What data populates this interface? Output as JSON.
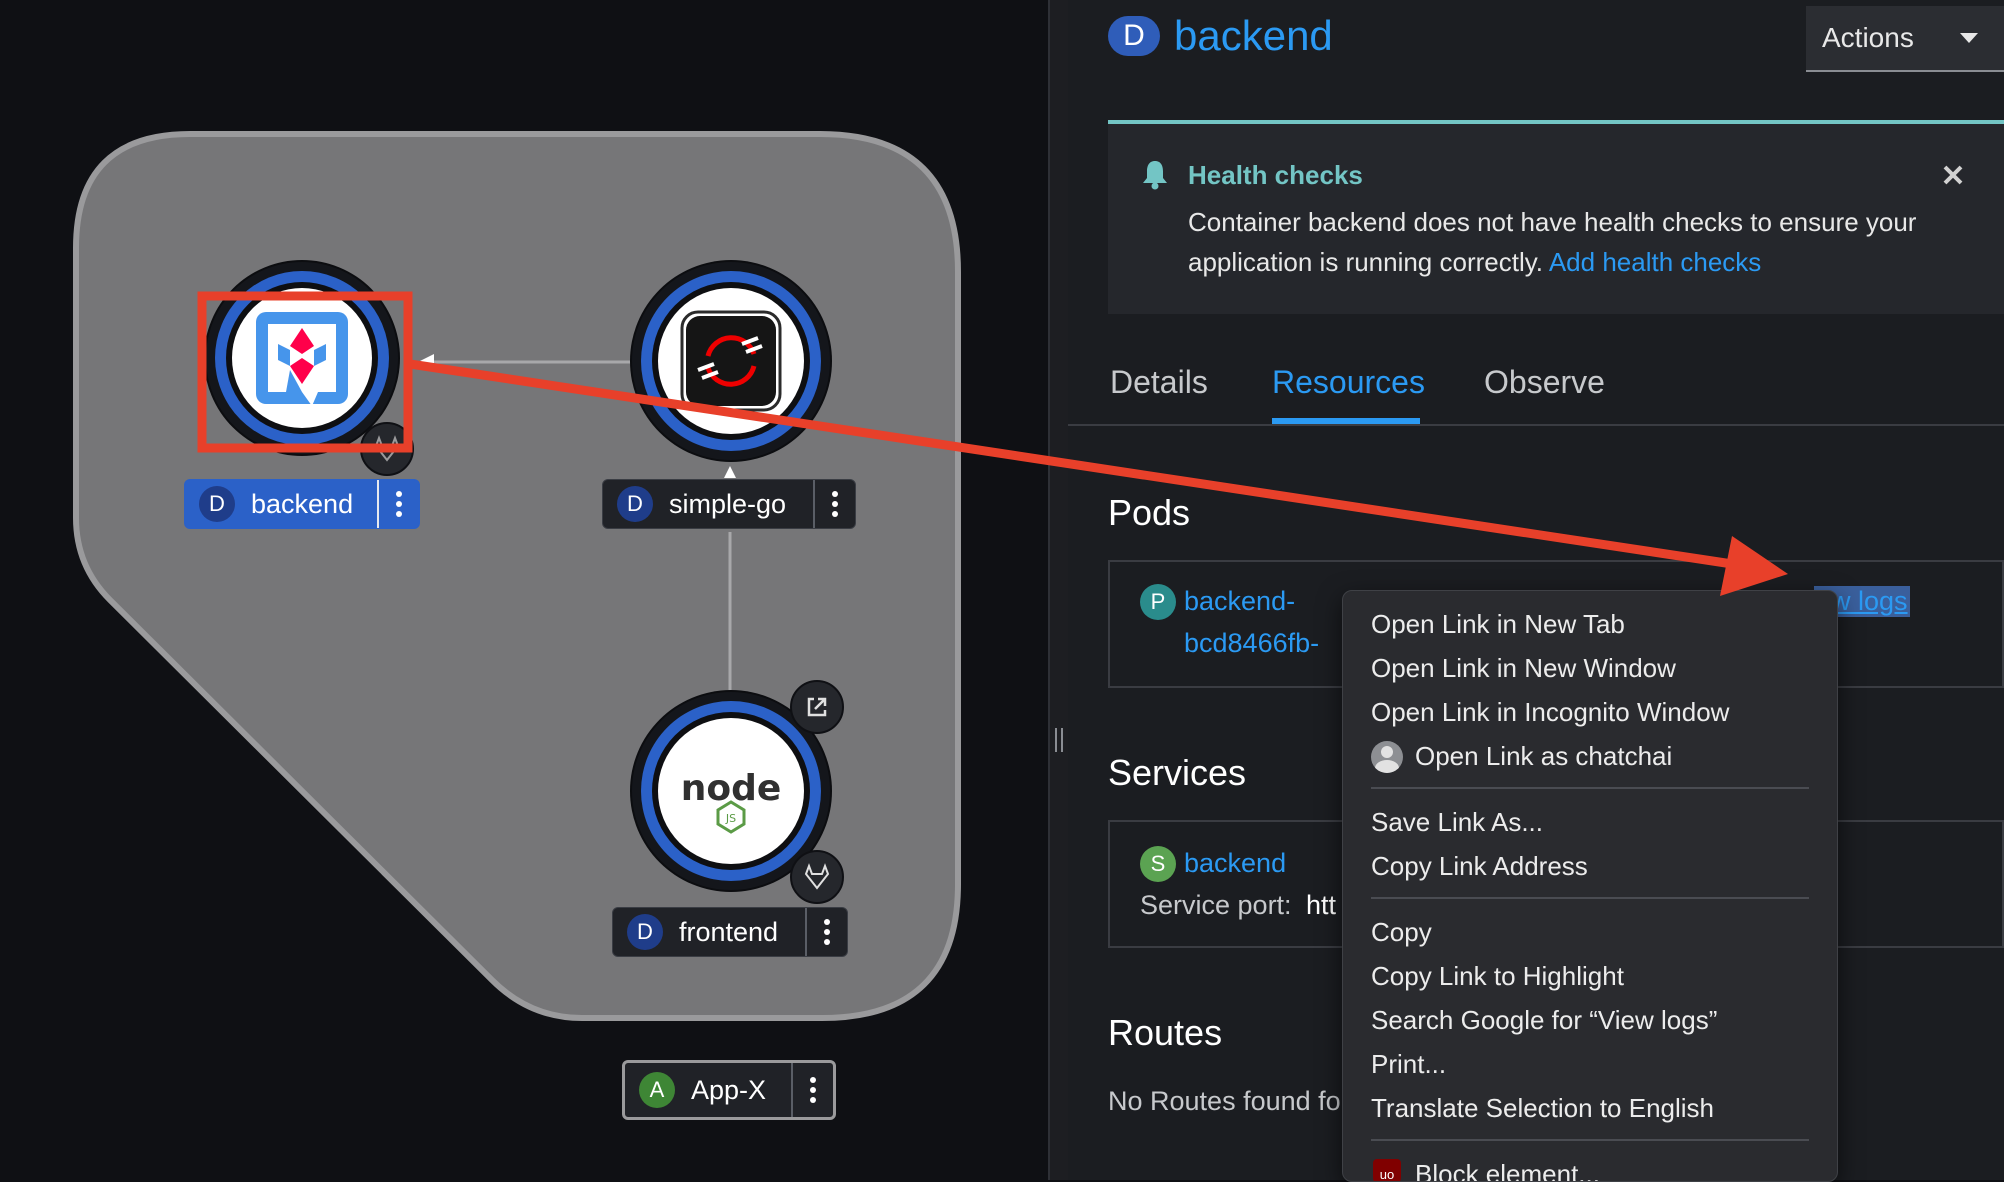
{
  "topology": {
    "nodes": [
      {
        "id": "backend",
        "kind_badge": "D",
        "label": "backend",
        "icon": "quarkus-logo",
        "decorator": "gitlab-icon"
      },
      {
        "id": "simple-go",
        "kind_badge": "D",
        "label": "simple-go",
        "icon": "openshift-logo"
      },
      {
        "id": "frontend",
        "kind_badge": "D",
        "label": "frontend",
        "icon": "nodejs-logo",
        "decorator": "gitlab-icon",
        "external_link": "external-link-icon"
      }
    ],
    "node_logo_text": {
      "node": "node",
      "js": "JS"
    },
    "application": {
      "badge": "A",
      "label": "App-X"
    }
  },
  "panel": {
    "title_badge": "D",
    "title": "backend",
    "actions_label": "Actions",
    "alert": {
      "title": "Health checks",
      "body": "Container backend does not have health checks to ensure your application is running correctly.",
      "link": "Add health checks"
    },
    "tabs": [
      "Details",
      "Resources",
      "Observe"
    ],
    "active_tab": "Resources",
    "pods": {
      "title": "Pods",
      "badge": "P",
      "name_line1": "backend-",
      "name_line2": "bcd8466fb-",
      "logs_link": "ew logs"
    },
    "services": {
      "title": "Services",
      "badge": "S",
      "name": "backend",
      "port_label": "Service port:",
      "port_value": "htt"
    },
    "routes": {
      "title": "Routes",
      "empty_text": "No Routes found fo"
    }
  },
  "context_menu": {
    "items_group1": [
      "Open Link in New Tab",
      "Open Link in New Window",
      "Open Link in Incognito Window",
      "Open Link as chatchai"
    ],
    "items_group2": [
      "Save Link As...",
      "Copy Link Address"
    ],
    "items_group3": [
      "Copy",
      "Copy Link to Highlight",
      "Search Google for “View logs”",
      "Print...",
      "Translate Selection to English"
    ],
    "items_group4": [
      "Block element..."
    ],
    "ublock_badge": "uo"
  },
  "colors": {
    "accent_blue": "#2b9af3",
    "node_ring_blue": "#2b61c8",
    "annotation_red": "#e8402a",
    "alert_teal": "#73c5c5",
    "pod_badge": "#2a8c8c",
    "service_badge": "#5ba352",
    "app_badge": "#3e8635"
  }
}
